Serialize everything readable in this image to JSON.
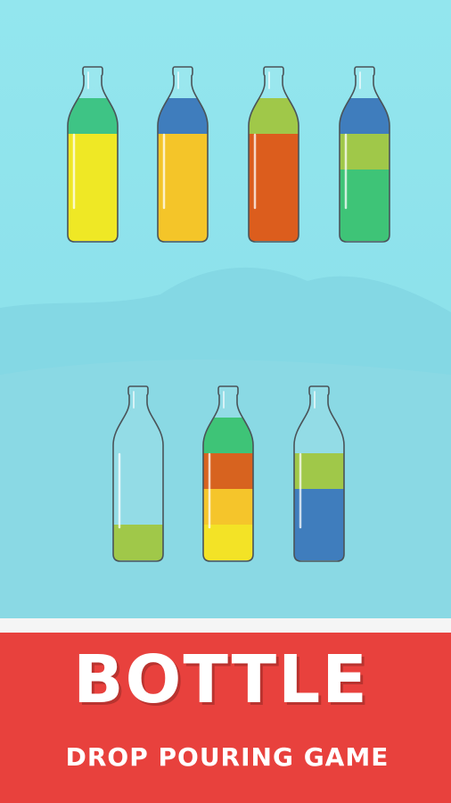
{
  "banner": {
    "title": "BOTTLE",
    "subtitle": "DROP POURING GAME"
  },
  "colors": {
    "sky": "#8fe3eb",
    "banner_red": "#e8413d",
    "yellow": "#eee613",
    "orange_yellow": "#f4c117",
    "red_orange": "#d9500a",
    "dark_orange": "#d4560c",
    "green": "#33c46a",
    "lime": "#9ac93a",
    "blue": "#2f72b8"
  },
  "bottles": [
    {
      "id": "b1",
      "layers": [
        {
          "color": "#eee613",
          "units": 3
        },
        {
          "color": "#2ebf7b",
          "units": 1
        }
      ]
    },
    {
      "id": "b2",
      "layers": [
        {
          "color": "#f4c117",
          "units": 3
        },
        {
          "color": "#2f72b8",
          "units": 1
        }
      ]
    },
    {
      "id": "b3",
      "layers": [
        {
          "color": "#d9500a",
          "units": 3
        },
        {
          "color": "#98c43a",
          "units": 1
        }
      ]
    },
    {
      "id": "b4",
      "layers": [
        {
          "color": "#2ebf6c",
          "units": 2
        },
        {
          "color": "#98c43a",
          "units": 1
        },
        {
          "color": "#2f72b8",
          "units": 1
        }
      ]
    },
    {
      "id": "b5",
      "layers": [
        {
          "color": "#98c43a",
          "units": 1
        }
      ]
    },
    {
      "id": "b6",
      "layers": [
        {
          "color": "#f2e114",
          "units": 1
        },
        {
          "color": "#f5c11a",
          "units": 1
        },
        {
          "color": "#d4560c",
          "units": 1
        },
        {
          "color": "#2ebf6c",
          "units": 1
        }
      ]
    },
    {
      "id": "b7",
      "layers": [
        {
          "color": "#2f72b8",
          "units": 2
        },
        {
          "color": "#98c43a",
          "units": 1
        }
      ]
    }
  ]
}
